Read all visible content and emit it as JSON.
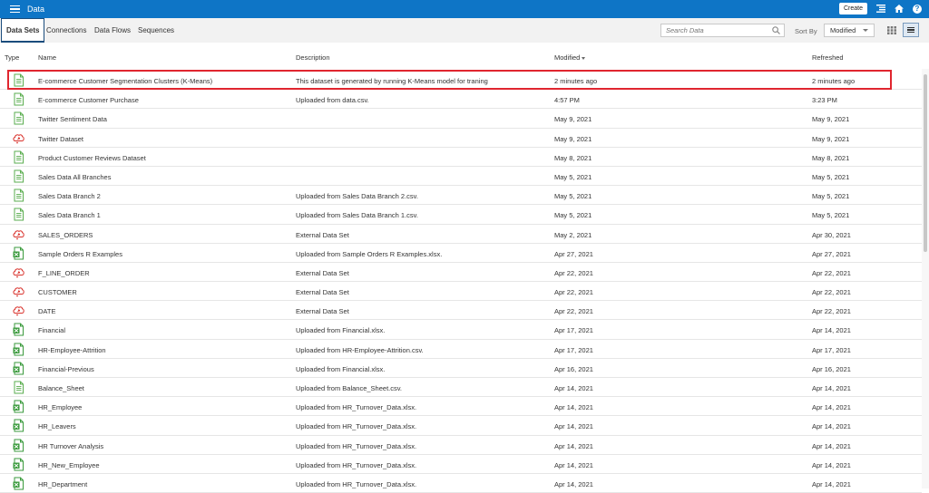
{
  "header": {
    "app_title": "Data",
    "create_label": "Create",
    "help_label": "?"
  },
  "tabs": [
    {
      "label": "Data Sets",
      "active": true
    },
    {
      "label": "Connections"
    },
    {
      "label": "Data Flows"
    },
    {
      "label": "Sequences"
    }
  ],
  "toolbar": {
    "search_placeholder": "Search Data",
    "sort_by_label": "Sort By",
    "sort_value": "Modified"
  },
  "colors": {
    "topbar": "#0e75c6",
    "highlight": "#e0262f",
    "file_icon": "#5aad4f",
    "excel_icon": "#3a9a3c",
    "connection_icon": "#d9322c"
  },
  "columns": {
    "type": "Type",
    "name": "Name",
    "description": "Description",
    "modified": "Modified",
    "refreshed": "Refreshed"
  },
  "rows": [
    {
      "icon": "csv-file-icon",
      "name": "E-commerce Customer Segmentation Clusters (K-Means)",
      "description": "This dataset is generated by running K-Means model for traning",
      "modified": "2 minutes ago",
      "refreshed": "2 minutes ago"
    },
    {
      "icon": "csv-file-icon",
      "name": "E-commerce Customer Purchase",
      "description": "Uploaded from data.csv.",
      "modified": "4:57 PM",
      "refreshed": "3:23 PM"
    },
    {
      "icon": "csv-file-icon",
      "name": "Twitter Sentiment Data",
      "description": "",
      "modified": "May 9, 2021",
      "refreshed": "May 9, 2021"
    },
    {
      "icon": "cloud-connection-icon",
      "name": "Twitter Dataset",
      "description": "",
      "modified": "May 9, 2021",
      "refreshed": "May 9, 2021"
    },
    {
      "icon": "csv-file-icon",
      "name": "Product Customer Reviews Dataset",
      "description": "",
      "modified": "May 8, 2021",
      "refreshed": "May 8, 2021"
    },
    {
      "icon": "csv-file-icon",
      "name": "Sales Data All Branches",
      "description": "",
      "modified": "May 5, 2021",
      "refreshed": "May 5, 2021"
    },
    {
      "icon": "csv-file-icon",
      "name": "Sales Data Branch 2",
      "description": "Uploaded from Sales Data Branch 2.csv.",
      "modified": "May 5, 2021",
      "refreshed": "May 5, 2021"
    },
    {
      "icon": "csv-file-icon",
      "name": "Sales Data Branch 1",
      "description": "Uploaded from Sales Data Branch 1.csv.",
      "modified": "May 5, 2021",
      "refreshed": "May 5, 2021"
    },
    {
      "icon": "cloud-connection-icon",
      "name": "SALES_ORDERS",
      "description": "External Data Set",
      "modified": "May 2, 2021",
      "refreshed": "Apr 30, 2021"
    },
    {
      "icon": "excel-file-icon",
      "name": "Sample Orders R Examples",
      "description": "Uploaded from Sample Orders R Examples.xlsx.",
      "modified": "Apr 27, 2021",
      "refreshed": "Apr 27, 2021"
    },
    {
      "icon": "cloud-connection-icon",
      "name": "F_LINE_ORDER",
      "description": "External Data Set",
      "modified": "Apr 22, 2021",
      "refreshed": "Apr 22, 2021"
    },
    {
      "icon": "cloud-connection-icon",
      "name": "CUSTOMER",
      "description": "External Data Set",
      "modified": "Apr 22, 2021",
      "refreshed": "Apr 22, 2021"
    },
    {
      "icon": "cloud-connection-icon",
      "name": "DATE",
      "description": "External Data Set",
      "modified": "Apr 22, 2021",
      "refreshed": "Apr 22, 2021"
    },
    {
      "icon": "excel-file-icon",
      "name": "Financial",
      "description": "Uploaded from Financial.xlsx.",
      "modified": "Apr 17, 2021",
      "refreshed": "Apr 14, 2021"
    },
    {
      "icon": "excel-file-icon",
      "name": "HR-Employee-Attrition",
      "description": "Uploaded from HR-Employee-Attrition.csv.",
      "modified": "Apr 17, 2021",
      "refreshed": "Apr 17, 2021"
    },
    {
      "icon": "excel-file-icon",
      "name": "Financial-Previous",
      "description": "Uploaded from Financial.xlsx.",
      "modified": "Apr 16, 2021",
      "refreshed": "Apr 16, 2021"
    },
    {
      "icon": "csv-file-icon",
      "name": "Balance_Sheet",
      "description": "Uploaded from Balance_Sheet.csv.",
      "modified": "Apr 14, 2021",
      "refreshed": "Apr 14, 2021"
    },
    {
      "icon": "excel-file-icon",
      "name": "HR_Employee",
      "description": "Uploaded from HR_Turnover_Data.xlsx.",
      "modified": "Apr 14, 2021",
      "refreshed": "Apr 14, 2021"
    },
    {
      "icon": "excel-file-icon",
      "name": "HR_Leavers",
      "description": "Uploaded from HR_Turnover_Data.xlsx.",
      "modified": "Apr 14, 2021",
      "refreshed": "Apr 14, 2021"
    },
    {
      "icon": "excel-file-icon",
      "name": "HR Turnover Analysis",
      "description": "Uploaded from HR_Turnover_Data.xlsx.",
      "modified": "Apr 14, 2021",
      "refreshed": "Apr 14, 2021"
    },
    {
      "icon": "excel-file-icon",
      "name": "HR_New_Employee",
      "description": "Uploaded from HR_Turnover_Data.xlsx.",
      "modified": "Apr 14, 2021",
      "refreshed": "Apr 14, 2021"
    },
    {
      "icon": "excel-file-icon",
      "name": "HR_Department",
      "description": "Uploaded from HR_Turnover_Data.xlsx.",
      "modified": "Apr 14, 2021",
      "refreshed": "Apr 14, 2021"
    }
  ]
}
